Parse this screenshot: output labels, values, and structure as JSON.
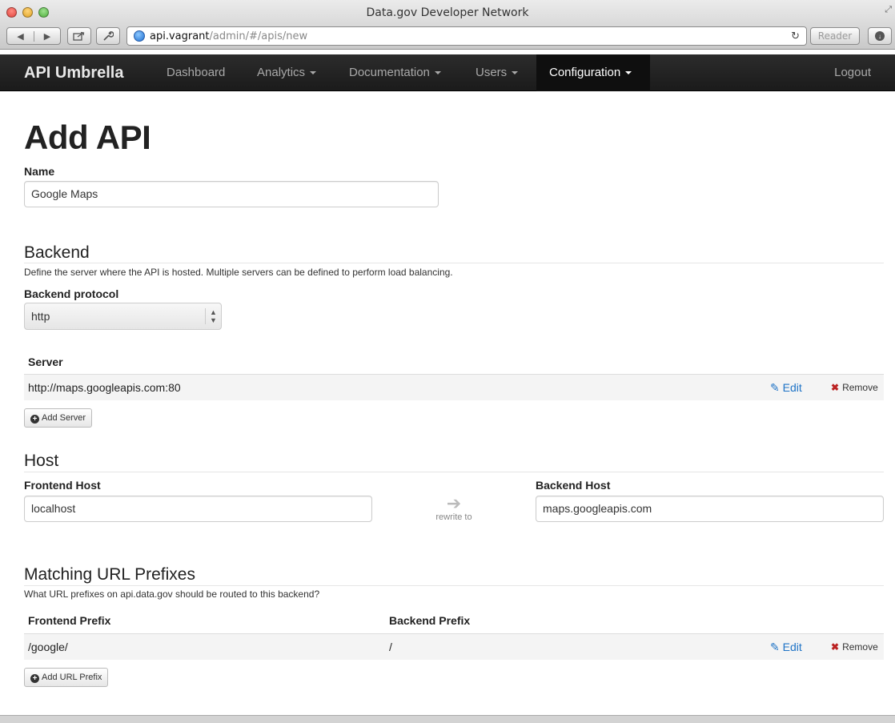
{
  "browser": {
    "window_title": "Data.gov Developer Network",
    "url_host": "api.vagrant",
    "url_path": "/admin/#/apis/new",
    "reader_label": "Reader",
    "back_glyph": "◀",
    "forward_glyph": "▶",
    "reload_glyph": "↻"
  },
  "navbar": {
    "brand": "API Umbrella",
    "items": [
      {
        "label": "Dashboard",
        "dropdown": false,
        "active": false
      },
      {
        "label": "Analytics",
        "dropdown": true,
        "active": false
      },
      {
        "label": "Documentation",
        "dropdown": true,
        "active": false
      },
      {
        "label": "Users",
        "dropdown": true,
        "active": false
      },
      {
        "label": "Configuration",
        "dropdown": true,
        "active": true
      }
    ],
    "logout": "Logout"
  },
  "page": {
    "title": "Add API",
    "name_label": "Name",
    "name_value": "Google Maps"
  },
  "backend": {
    "title": "Backend",
    "help": "Define the server where the API is hosted. Multiple servers can be defined to perform load balancing.",
    "protocol_label": "Backend protocol",
    "protocol_value": "http",
    "server_header": "Server",
    "servers": [
      {
        "url": "http://maps.googleapis.com:80"
      }
    ],
    "edit_label": "Edit",
    "remove_label": "Remove",
    "add_server_label": "Add Server"
  },
  "host": {
    "title": "Host",
    "frontend_label": "Frontend Host",
    "frontend_value": "localhost",
    "rewrite_label": "rewrite to",
    "backend_label": "Backend Host",
    "backend_value": "maps.googleapis.com"
  },
  "prefixes": {
    "title": "Matching URL Prefixes",
    "help": "What URL prefixes on api.data.gov should be routed to this backend?",
    "frontend_header": "Frontend Prefix",
    "backend_header": "Backend Prefix",
    "rows": [
      {
        "frontend": "/google/",
        "backend": "/"
      }
    ],
    "edit_label": "Edit",
    "remove_label": "Remove",
    "add_label": "Add URL Prefix"
  },
  "colors": {
    "navbar_bg": "#1b1b1b",
    "link": "#1e73c6",
    "remove_x": "#bb2222"
  }
}
